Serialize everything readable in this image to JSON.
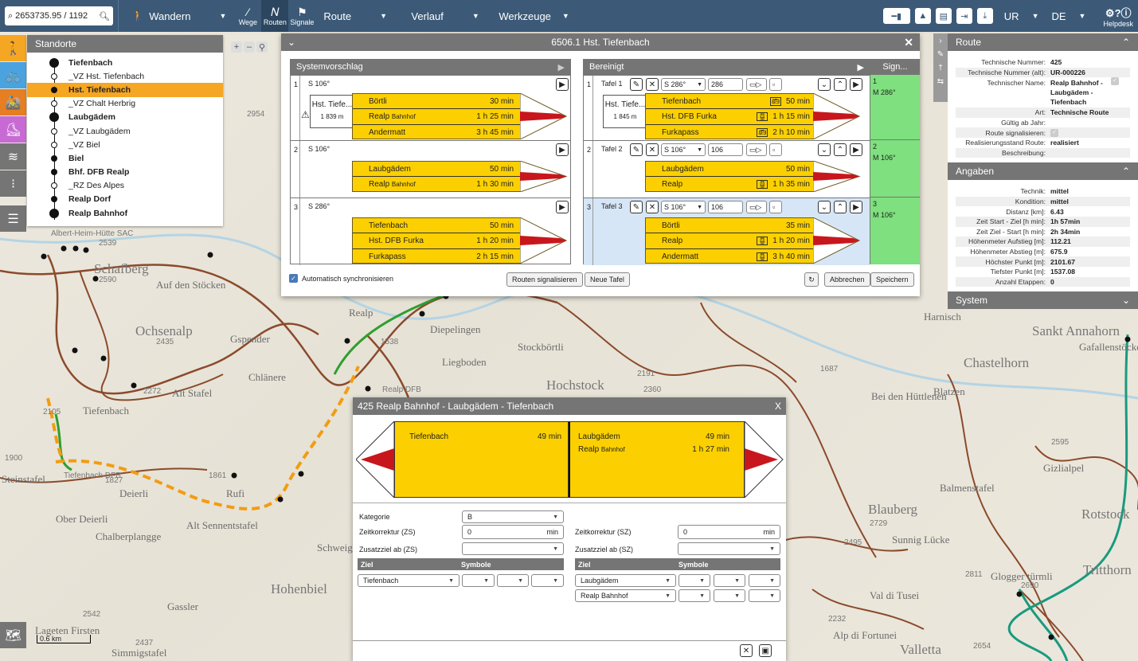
{
  "topbar": {
    "coordinates": "2653735.95 / 1192",
    "activity": "Wandern",
    "modes": [
      {
        "label": "Wege",
        "icon": "path-icon"
      },
      {
        "label": "Routen",
        "icon": "route-icon"
      },
      {
        "label": "Signale",
        "icon": "signpost-icon"
      }
    ],
    "menus": [
      "Route",
      "Verlauf",
      "Werkzeuge"
    ],
    "canton": "UR",
    "language": "DE",
    "help": "Helpdesk"
  },
  "standorte": {
    "title": "Standorte",
    "items": [
      {
        "label": "Tiefenbach",
        "bold": true,
        "dot": "big"
      },
      {
        "label": "_VZ Hst. Tiefenbach",
        "bold": false,
        "dot": "hollow"
      },
      {
        "label": "Hst. Tiefenbach",
        "bold": true,
        "dot": "filled",
        "selected": true
      },
      {
        "label": "_VZ Chalt Herbrig",
        "bold": false,
        "dot": "hollow"
      },
      {
        "label": "Laubgädem",
        "bold": true,
        "dot": "big"
      },
      {
        "label": "_VZ Laubgädem",
        "bold": false,
        "dot": "hollow"
      },
      {
        "label": "_VZ Biel",
        "bold": false,
        "dot": "hollow"
      },
      {
        "label": "Biel",
        "bold": true,
        "dot": "filled"
      },
      {
        "label": "Bhf. DFB Realp",
        "bold": true,
        "dot": "filled"
      },
      {
        "label": "_RZ Des Alpes",
        "bold": false,
        "dot": "hollow"
      },
      {
        "label": "Realp Dorf",
        "bold": true,
        "dot": "filled"
      },
      {
        "label": "Realp Bahnhof",
        "bold": true,
        "dot": "big"
      }
    ]
  },
  "dialog": {
    "title": "6506.1 Hst. Tiefenbach",
    "system_header": "Systemvorschlag",
    "clean_header": "Bereinigt",
    "sign_header": "Sign...",
    "system_rows": [
      {
        "num": "1",
        "dir": "S 106°",
        "hst": "Hst. Tiefe...",
        "alt": "1 839 m",
        "lines": [
          {
            "to": "Börtli",
            "sub": "",
            "t": "30 min"
          },
          {
            "to": "Realp",
            "sub": "Bahnhof",
            "t": "1 h 25 min"
          },
          {
            "to": "Andermatt",
            "sub": "",
            "t": "3 h 45 min"
          }
        ]
      },
      {
        "num": "2",
        "dir": "S 106°",
        "lines": [
          {
            "to": "Laubgädem",
            "sub": "",
            "t": "50 min"
          },
          {
            "to": "Realp",
            "sub": "Bahnhof",
            "t": "1 h 30 min"
          }
        ]
      },
      {
        "num": "3",
        "dir": "S 286°",
        "lines": [
          {
            "to": "Tiefenbach",
            "sub": "",
            "t": "50 min"
          },
          {
            "to": "Hst. DFB Furka",
            "sub": "",
            "t": "1 h 20 min"
          },
          {
            "to": "Furkapass",
            "sub": "",
            "t": "2 h 15 min"
          }
        ]
      }
    ],
    "clean_rows": [
      {
        "num": "1",
        "tafel": "Tafel 1",
        "dir": "S 286°",
        "val": "286",
        "hst": "Hst. Tiefe...",
        "alt": "1 845 m",
        "sig_num": "1",
        "sig_dir": "M 286°",
        "lines": [
          {
            "to": "Tiefenbach",
            "t": "50 min"
          },
          {
            "to": "Hst. DFB Furka",
            "t": "1 h 15 min"
          },
          {
            "to": "Furkapass",
            "t": "2 h 10 min"
          }
        ]
      },
      {
        "num": "2",
        "tafel": "Tafel 2",
        "dir": "S 106°",
        "val": "106",
        "sig_num": "2",
        "sig_dir": "M 106°",
        "lines": [
          {
            "to": "Laubgädem",
            "t": "50 min"
          },
          {
            "to": "Realp",
            "t": "1 h 35 min"
          }
        ]
      },
      {
        "num": "3",
        "tafel": "Tafel 3",
        "dir": "S 106°",
        "val": "106",
        "sig_num": "3",
        "sig_dir": "M 106°",
        "lines": [
          {
            "to": "Börtli",
            "t": "35 min"
          },
          {
            "to": "Realp",
            "t": "1 h 20 min"
          },
          {
            "to": "Andermatt",
            "t": "3 h 40 min"
          }
        ]
      }
    ],
    "auto_sync": "Automatisch synchronisieren",
    "btn_signal": "Routen signalisieren",
    "btn_new": "Neue Tafel",
    "btn_cancel": "Abbrechen",
    "btn_save": "Speichern"
  },
  "route_panel": {
    "title": "Route",
    "rows": [
      {
        "k": "Technische Nummer:",
        "v": "425"
      },
      {
        "k": "Technische Nummer (alt):",
        "v": "UR-000226"
      },
      {
        "k": "Technischer Name:",
        "v": "Realp Bahnhof - Laubgädem - Tiefenbach"
      },
      {
        "k": "Art:",
        "v": "Technische Route"
      },
      {
        "k": "Gültig ab Jahr:",
        "v": ""
      },
      {
        "k": "Route signalisieren:",
        "v": ""
      },
      {
        "k": "Realisierungsstand Route:",
        "v": "realisiert"
      },
      {
        "k": "Beschreibung:",
        "v": ""
      }
    ],
    "angaben_title": "Angaben",
    "angaben": [
      {
        "k": "Technik:",
        "v": "mittel"
      },
      {
        "k": "Kondition:",
        "v": "mittel"
      },
      {
        "k": "Distanz [km]:",
        "v": "6.43"
      },
      {
        "k": "Zeit Start - Ziel [h min]:",
        "v": "1h 57min"
      },
      {
        "k": "Zeit Ziel - Start [h min]:",
        "v": "2h 34min"
      },
      {
        "k": "Höhenmeter Aufstieg [m]:",
        "v": "112.21"
      },
      {
        "k": "Höhenmeter Abstieg [m]:",
        "v": "675.9"
      },
      {
        "k": "Höchster Punkt [m]:",
        "v": "2101.67"
      },
      {
        "k": "Tiefster Punkt [m]:",
        "v": "1537.08"
      },
      {
        "k": "Anzahl Etappen:",
        "v": "0"
      }
    ],
    "system_title": "System"
  },
  "route_dialog": {
    "title": "425 Realp Bahnhof - Laubgädem - Tiefenbach",
    "left_sign": [
      {
        "to": "Tiefenbach",
        "t": "49 min"
      }
    ],
    "right_sign": [
      {
        "to": "Laubgädem",
        "sub": "",
        "t": "49 min"
      },
      {
        "to": "Realp",
        "sub": "Bahnhof",
        "t": "1 h 27 min"
      }
    ],
    "kategorie_label": "Kategorie",
    "kategorie_value": "B",
    "zs_label": "Zeitkorrektur (ZS)",
    "zs_value": "0",
    "sz_label": "Zeitkorrektur (SZ)",
    "sz_value": "0",
    "unit": "min",
    "zz_zs_label": "Zusatzziel ab (ZS)",
    "zz_sz_label": "Zusatzziel ab (SZ)",
    "ziel_header": "Ziel",
    "symbole_header": "Symbole",
    "left_ziel": [
      "Tiefenbach"
    ],
    "right_ziel": [
      "Laubgädem",
      "Realp Bahnhof"
    ]
  },
  "map": {
    "scale": "0.6 km",
    "labels": [
      {
        "t": "Schafberg",
        "c": "maplbl big"
      },
      {
        "t": "Ochsenalp",
        "c": "maplbl big"
      },
      {
        "t": "Realp",
        "c": "maplbl"
      },
      {
        "t": "Hochstock",
        "c": "maplbl big"
      },
      {
        "t": "Chastelhorn",
        "c": "maplbl big"
      },
      {
        "t": "Sankt Annahorn",
        "c": "maplbl big"
      },
      {
        "t": "Rotstock",
        "c": "maplbl big"
      },
      {
        "t": "Tritthorn",
        "c": "maplbl big"
      },
      {
        "t": "Blauberg",
        "c": "maplbl big"
      },
      {
        "t": "Hohenbiel",
        "c": "maplbl big"
      },
      {
        "t": "Gspender",
        "c": "maplbl"
      },
      {
        "t": "Chlänere",
        "c": "maplbl"
      },
      {
        "t": "Alt Stafel",
        "c": "maplbl"
      },
      {
        "t": "Tiefenbach",
        "c": "maplbl"
      },
      {
        "t": "Ober Deierli",
        "c": "maplbl"
      },
      {
        "t": "Chalberplangge",
        "c": "maplbl"
      },
      {
        "t": "Alt Sennentstafel",
        "c": "maplbl"
      },
      {
        "t": "Steinstafel",
        "c": "maplbl"
      },
      {
        "t": "Gassler",
        "c": "maplbl"
      },
      {
        "t": "Diepelingen",
        "c": "maplbl"
      },
      {
        "t": "Liegboden",
        "c": "maplbl"
      },
      {
        "t": "Stockbörtli",
        "c": "maplbl"
      },
      {
        "t": "Bei den Hüttlenen",
        "c": "maplbl"
      },
      {
        "t": "Valletta",
        "c": "maplbl big"
      },
      {
        "t": "Glogger türmli",
        "c": "maplbl"
      },
      {
        "t": "Auf den Stöcken",
        "c": "maplbl"
      },
      {
        "t": "Gafallenstöcke",
        "c": "maplbl"
      },
      {
        "t": "Harnisch",
        "c": "maplbl"
      },
      {
        "t": "Alp di Fortunei",
        "c": "maplbl"
      },
      {
        "t": "Val di Tusei",
        "c": "maplbl"
      },
      {
        "t": "Sunnig Lücke",
        "c": "maplbl"
      },
      {
        "t": "Balmenstafel",
        "c": "maplbl"
      },
      {
        "t": "Gizlialpel",
        "c": "maplbl"
      },
      {
        "t": "Blatzen",
        "c": "maplbl"
      },
      {
        "t": "Schweig",
        "c": "maplbl"
      },
      {
        "t": "Rufi",
        "c": "maplbl"
      },
      {
        "t": "Deierli",
        "c": "maplbl"
      },
      {
        "t": "Lageten Firsten",
        "c": "maplbl"
      },
      {
        "t": "Simmigstafel",
        "c": "maplbl"
      },
      {
        "t": "Albert-Heim-Hütte SAC",
        "c": "maplbl sm"
      },
      {
        "t": "Tiefenbach DFB",
        "c": "maplbl sm"
      },
      {
        "t": "Realp DFB",
        "c": "maplbl sm"
      },
      {
        "t": "2954",
        "c": "maplbl sm"
      },
      {
        "t": "2539",
        "c": "maplbl sm"
      },
      {
        "t": "2590",
        "c": "maplbl sm"
      },
      {
        "t": "2435",
        "c": "maplbl sm"
      },
      {
        "t": "2272",
        "c": "maplbl sm"
      },
      {
        "t": "2105",
        "c": "maplbl sm"
      },
      {
        "t": "1900",
        "c": "maplbl sm"
      },
      {
        "t": "1827",
        "c": "maplbl sm"
      },
      {
        "t": "1861",
        "c": "maplbl sm"
      },
      {
        "t": "2542",
        "c": "maplbl sm"
      },
      {
        "t": "2437",
        "c": "maplbl sm"
      },
      {
        "t": "2360",
        "c": "maplbl sm"
      },
      {
        "t": "2191",
        "c": "maplbl sm"
      },
      {
        "t": "1687",
        "c": "maplbl sm"
      },
      {
        "t": "2495",
        "c": "maplbl sm"
      },
      {
        "t": "2811",
        "c": "maplbl sm"
      },
      {
        "t": "2690",
        "c": "maplbl sm"
      },
      {
        "t": "2654",
        "c": "maplbl sm"
      },
      {
        "t": "2729",
        "c": "maplbl sm"
      },
      {
        "t": "2595",
        "c": "maplbl sm"
      },
      {
        "t": "2232",
        "c": "maplbl sm"
      },
      {
        "t": "1538",
        "c": "maplbl sm"
      }
    ]
  },
  "colors": {
    "accent": "#f5a623",
    "topbar": "#3c5a78",
    "header": "#757575",
    "sign": "#fcd000",
    "signal_ok": "#7ee07e"
  }
}
